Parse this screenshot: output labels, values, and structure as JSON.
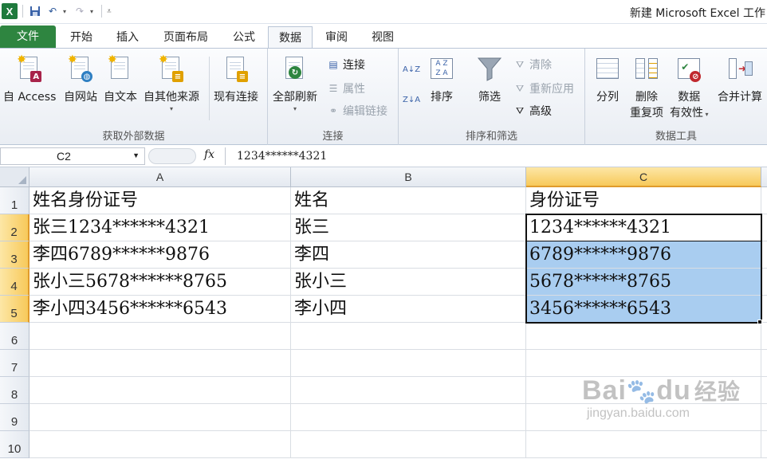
{
  "window": {
    "title": "新建 Microsoft Excel 工作"
  },
  "qat": {
    "app_icon": "X"
  },
  "tabs": [
    "文件",
    "开始",
    "插入",
    "页面布局",
    "公式",
    "数据",
    "审阅",
    "视图"
  ],
  "active_tab": "数据",
  "ribbon": {
    "groups": [
      {
        "label": "获取外部数据",
        "buttons": [
          "自 Access",
          "自网站",
          "自文本",
          "自其他来源",
          "现有连接"
        ]
      },
      {
        "label": "连接",
        "refresh_all": "全部刷新",
        "small": [
          "连接",
          "属性",
          "编辑链接"
        ]
      },
      {
        "label": "排序和筛选",
        "sort": "排序",
        "filter": "筛选",
        "small": [
          "清除",
          "重新应用",
          "高级"
        ]
      },
      {
        "label": "数据工具",
        "buttons": [
          "分列",
          "删除",
          "重复项",
          "数据",
          "有效性",
          "合并计算"
        ]
      }
    ]
  },
  "formula_bar": {
    "name_box": "C2",
    "fx": "fx",
    "value": "1234******4321"
  },
  "grid": {
    "columns": [
      "A",
      "B",
      "C"
    ],
    "selected_column": "C",
    "rows": [
      "1",
      "2",
      "3",
      "4",
      "5",
      "6",
      "7",
      "8",
      "9",
      "10"
    ],
    "cells": [
      [
        "姓名身份证号",
        "姓名",
        "身份证号"
      ],
      [
        "张三1234******4321",
        "张三",
        "1234******4321"
      ],
      [
        "李四6789******9876",
        "李四",
        "6789******9876"
      ],
      [
        "张小三5678******8765",
        "张小三",
        "5678******8765"
      ],
      [
        "李小四3456******6543",
        "李小四",
        "3456******6543"
      ]
    ]
  },
  "watermark": {
    "main": "Bai",
    "main2": "du",
    "cn": "经验",
    "sub": "jingyan.baidu.com"
  }
}
